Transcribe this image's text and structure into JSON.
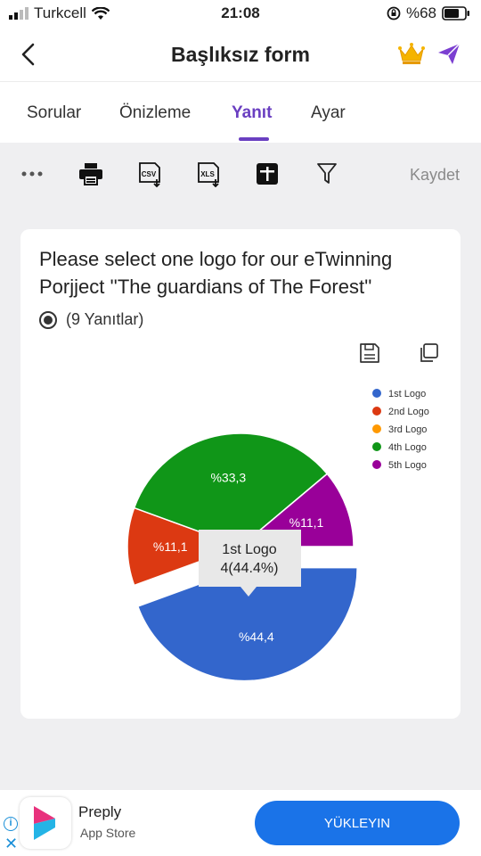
{
  "status": {
    "carrier": "Turkcell",
    "time": "21:08",
    "battery": "%68"
  },
  "header": {
    "title": "Başlıksız form"
  },
  "tabs": [
    {
      "label": "Sorular"
    },
    {
      "label": "Önizleme"
    },
    {
      "label": "Yanıt",
      "active": true
    },
    {
      "label": "Ayar"
    }
  ],
  "toolbar": {
    "icons": [
      "more-icon",
      "print-icon",
      "csv-download-icon",
      "xls-download-icon",
      "add-box-icon",
      "filter-icon"
    ],
    "csv_label": "CSV",
    "xls_label": "XLS",
    "save_label": "Kaydet"
  },
  "question": {
    "title": "Please select one logo for our eTwinning Porjject ''The guardians of The Forest''",
    "responses": "(9 Yanıtlar)"
  },
  "chart_data": {
    "type": "pie",
    "categories": [
      "1st Logo",
      "2nd Logo",
      "3rd Logo",
      "4th Logo",
      "5th Logo"
    ],
    "values": [
      4,
      1,
      0,
      3,
      1
    ],
    "slice_labels": [
      "%44,4",
      "%11,1",
      "",
      "%33,3",
      "%11,1"
    ],
    "colors": [
      "#3366cc",
      "#dc3912",
      "#ff9900",
      "#109618",
      "#990099"
    ],
    "legend_position": "top-right",
    "tooltip": {
      "line1": "1st Logo",
      "line2": "4(44.4%)"
    }
  },
  "ad": {
    "name": "Preply",
    "subtitle": "App Store",
    "button": "YÜKLEYIN"
  }
}
